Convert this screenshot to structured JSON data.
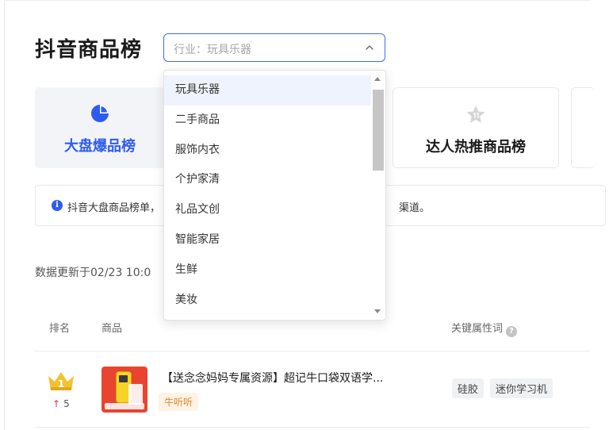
{
  "page": {
    "title": "抖音商品榜"
  },
  "industry_select": {
    "text": "行业：玩具乐器",
    "icon": "chevron-up-icon"
  },
  "cards": [
    {
      "label": "大盘爆品榜",
      "icon": "pie-chart-icon",
      "active": true,
      "color": "#2f5cf0"
    },
    {
      "label": "达人热推商品榜",
      "icon": "star-badge-icon",
      "active": false
    }
  ],
  "notice": {
    "icon": "info-icon",
    "left_text": "抖音大盘商品榜单，",
    "right_text": "渠道。"
  },
  "update": {
    "text": "数据更新于02/23 10:0"
  },
  "table": {
    "headers": {
      "rank": "排名",
      "product": "商品",
      "attributes": "关键属性词"
    },
    "rows": [
      {
        "rank_change": "5",
        "title": "【送念念妈妈专属资源】超记牛口袋双语学...",
        "shop": "牛听听",
        "attributes": [
          "硅胶",
          "迷你学习机"
        ]
      }
    ]
  },
  "dropdown": {
    "options": [
      "玩具乐器",
      "二手商品",
      "服饰内衣",
      "个护家清",
      "礼品文创",
      "智能家居",
      "生鲜",
      "美妆"
    ],
    "selected": "玩具乐器"
  },
  "colors": {
    "accent": "#2f5cf0",
    "select_border": "#3b6cf6",
    "rank_up": "#e03b3b",
    "shop_tag": "#e0862a"
  }
}
